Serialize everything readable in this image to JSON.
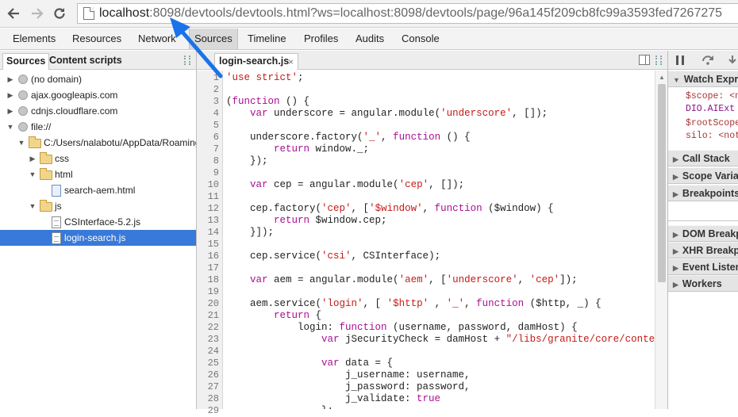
{
  "browser": {
    "url_host": "localhost",
    "url_rest": ":8098/devtools/devtools.html?ws=localhost:8098/devtools/page/96a145f209cb8fc99a3593fed7267275"
  },
  "devtools_tabs": [
    "Elements",
    "Resources",
    "Network",
    "Sources",
    "Timeline",
    "Profiles",
    "Audits",
    "Console"
  ],
  "active_tab": "Sources",
  "left_panel": {
    "tabs": [
      "Sources",
      "Content scripts"
    ],
    "tree": [
      {
        "label": "(no domain)",
        "type": "domain",
        "depth": 0,
        "arrow": "collapsed"
      },
      {
        "label": "ajax.googleapis.com",
        "type": "domain",
        "depth": 0,
        "arrow": "collapsed"
      },
      {
        "label": "cdnjs.cloudflare.com",
        "type": "domain",
        "depth": 0,
        "arrow": "collapsed"
      },
      {
        "label": "file://",
        "type": "domain",
        "depth": 0,
        "arrow": "expanded"
      },
      {
        "label": "C:/Users/nalabotu/AppData/Roaming/",
        "type": "folder",
        "depth": 1,
        "arrow": "expanded"
      },
      {
        "label": "css",
        "type": "folder",
        "depth": 2,
        "arrow": "collapsed"
      },
      {
        "label": "html",
        "type": "folder",
        "depth": 2,
        "arrow": "expanded"
      },
      {
        "label": "search-aem.html",
        "type": "html",
        "depth": 3,
        "arrow": ""
      },
      {
        "label": "js",
        "type": "folder",
        "depth": 2,
        "arrow": "expanded"
      },
      {
        "label": "CSInterface-5.2.js",
        "type": "js",
        "depth": 3,
        "arrow": ""
      },
      {
        "label": "login-search.js",
        "type": "js",
        "depth": 3,
        "arrow": "",
        "selected": true
      }
    ]
  },
  "editor": {
    "open_file": "login-search.js",
    "close_glyph": "×",
    "lines": [
      [
        [
          "str",
          "'use strict'"
        ],
        [
          "",
          "; "
        ]
      ],
      [],
      [
        [
          "",
          "("
        ],
        [
          "kw",
          "function"
        ],
        [
          "",
          " () {"
        ]
      ],
      [
        [
          "",
          "    "
        ],
        [
          "kw",
          "var"
        ],
        [
          "",
          " underscore = angular.module("
        ],
        [
          "str",
          "'underscore'"
        ],
        [
          "",
          ", []);"
        ]
      ],
      [],
      [
        [
          "",
          "    underscore.factory("
        ],
        [
          "str",
          "'_'"
        ],
        [
          "",
          ", "
        ],
        [
          "kw",
          "function"
        ],
        [
          "",
          " () {"
        ]
      ],
      [
        [
          "",
          "        "
        ],
        [
          "kw",
          "return"
        ],
        [
          "",
          " window._;"
        ]
      ],
      [
        [
          "",
          "    });"
        ]
      ],
      [],
      [
        [
          "",
          "    "
        ],
        [
          "kw",
          "var"
        ],
        [
          "",
          " cep = angular.module("
        ],
        [
          "str",
          "'cep'"
        ],
        [
          "",
          ", []);"
        ]
      ],
      [],
      [
        [
          "",
          "    cep.factory("
        ],
        [
          "str",
          "'cep'"
        ],
        [
          "",
          ", ["
        ],
        [
          "str",
          "'$window'"
        ],
        [
          "",
          ", "
        ],
        [
          "kw",
          "function"
        ],
        [
          "",
          " ($window) {"
        ]
      ],
      [
        [
          "",
          "        "
        ],
        [
          "kw",
          "return"
        ],
        [
          "",
          " $window.cep;"
        ]
      ],
      [
        [
          "",
          "    }]);"
        ]
      ],
      [],
      [
        [
          "",
          "    cep.service("
        ],
        [
          "str",
          "'csi'"
        ],
        [
          "",
          ", CSInterface);"
        ]
      ],
      [],
      [
        [
          "",
          "    "
        ],
        [
          "kw",
          "var"
        ],
        [
          "",
          " aem = angular.module("
        ],
        [
          "str",
          "'aem'"
        ],
        [
          "",
          ", ["
        ],
        [
          "str",
          "'underscore'"
        ],
        [
          "",
          ", "
        ],
        [
          "str",
          "'cep'"
        ],
        [
          "",
          "]);"
        ]
      ],
      [],
      [
        [
          "",
          "    aem.service("
        ],
        [
          "str",
          "'login'"
        ],
        [
          "",
          ", [ "
        ],
        [
          "str",
          "'$http'"
        ],
        [
          "",
          " , "
        ],
        [
          "str",
          "'_'"
        ],
        [
          "",
          ", "
        ],
        [
          "kw",
          "function"
        ],
        [
          "",
          " ($http, _) {"
        ]
      ],
      [
        [
          "",
          "        "
        ],
        [
          "kw",
          "return"
        ],
        [
          "",
          " {"
        ]
      ],
      [
        [
          "",
          "            login: "
        ],
        [
          "kw",
          "function"
        ],
        [
          "",
          " (username, password, damHost) {"
        ]
      ],
      [
        [
          "",
          "                "
        ],
        [
          "kw",
          "var"
        ],
        [
          "",
          " jSecurityCheck = damHost + "
        ],
        [
          "str",
          "\"/libs/granite/core/content/"
        ]
      ],
      [],
      [
        [
          "",
          "                "
        ],
        [
          "kw",
          "var"
        ],
        [
          "",
          " data = {"
        ]
      ],
      [
        [
          "",
          "                    j_username: username,"
        ]
      ],
      [
        [
          "",
          "                    j_password: password,"
        ]
      ],
      [
        [
          "",
          "                    j_validate: "
        ],
        [
          "kw",
          "true"
        ]
      ],
      [
        [
          "",
          "                };"
        ]
      ]
    ]
  },
  "right_panel": {
    "watch": {
      "title": "Watch Expressions",
      "lines": [
        "$scope: <no",
        "DIO.AIExt",
        "$rootScope",
        "silo: <not"
      ]
    },
    "sections_top": [
      "Call Stack",
      "Scope Variables",
      "Breakpoints"
    ],
    "sections_bottom": [
      "DOM Breakpoints",
      "XHR Breakpoints",
      "Event Listener Breakpoints",
      "Workers"
    ]
  },
  "colors": {
    "selection": "#3879d9",
    "annotation_arrow": "#1a73e8"
  }
}
